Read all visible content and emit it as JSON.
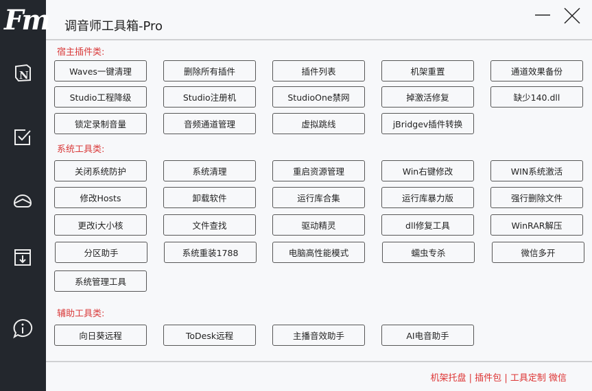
{
  "app": {
    "logo": "Fm",
    "title": "调音师工具箱-Pro"
  },
  "sidebar": {
    "icons": [
      "notion-icon",
      "checkbox-icon",
      "cloud-icon",
      "box-download-icon",
      "info-icon"
    ]
  },
  "sections": [
    {
      "label": "宿主插件类:",
      "buttons": [
        "Waves一键清理",
        "删除所有插件",
        "插件列表",
        "机架重置",
        "通道效果备份",
        "Studio工程降级",
        "Studio注册机",
        "StudioOne禁网",
        "掉激活修复",
        "缺少140.dll",
        "锁定录制音量",
        "音频通道管理",
        "虚拟跳线",
        "jBridgev插件转换"
      ]
    },
    {
      "label": "系统工具类:",
      "buttons": [
        "关闭系统防护",
        "系统清理",
        "重启资源管理",
        "Win右键修改",
        "WIN系统激活",
        "修改Hosts",
        "卸载软件",
        "运行库合集",
        "运行库暴力版",
        "强行删除文件",
        "更改i大小核",
        "文件查找",
        "驱动精灵",
        "dll修复工具",
        "WinRAR解压",
        "分区助手",
        "系统重装1788",
        "电脑高性能模式",
        "蠕虫专杀",
        "微信多开",
        "系统管理工具"
      ]
    },
    {
      "label": "辅助工具类:",
      "buttons": [
        "向日葵远程",
        "ToDesk远程",
        "主播音效助手",
        "AI电音助手"
      ]
    }
  ],
  "footer": {
    "links": [
      "机架托盘",
      "插件包",
      "工具定制 微信"
    ],
    "separator": "|"
  },
  "colors": {
    "sidebar": "#23272d",
    "accent": "#d93a3a",
    "background": "#f7f8fa"
  }
}
